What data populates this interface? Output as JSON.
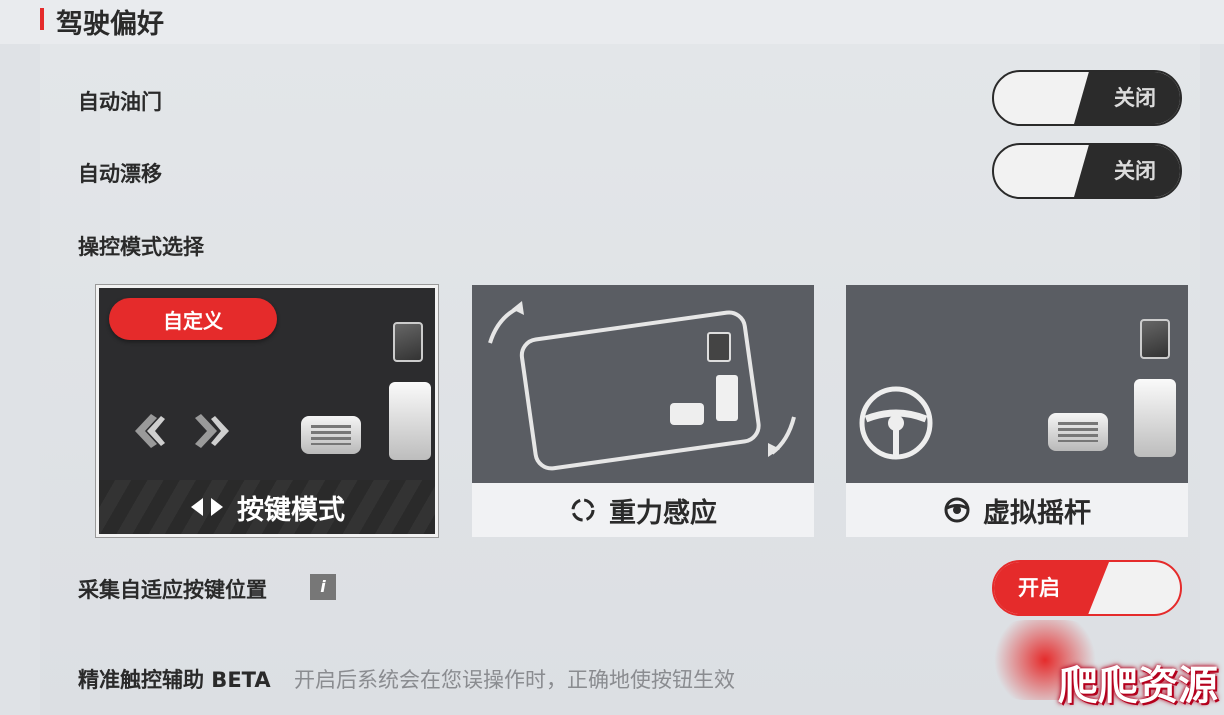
{
  "header": {
    "title": "驾驶偏好"
  },
  "settings": {
    "auto_throttle": {
      "label": "自动油门",
      "state": "关闭"
    },
    "auto_drift": {
      "label": "自动漂移",
      "state": "关闭"
    },
    "control_mode_label": "操控模式选择",
    "modes": [
      {
        "label": "按键模式",
        "badge": "自定义",
        "selected": true
      },
      {
        "label": "重力感应",
        "selected": false
      },
      {
        "label": "虚拟摇杆",
        "selected": false
      }
    ],
    "adaptive_keys": {
      "label": "采集自适应按键位置",
      "state": "开启",
      "info_icon": "i"
    },
    "precise_touch": {
      "label": "精准触控辅助 BETA",
      "description": "开启后系统会在您误操作时，正确地使按钮生效"
    }
  },
  "watermark": "爬爬资源",
  "colors": {
    "accent": "#e52b2b",
    "dark": "#2b2b2b",
    "panel": "#dcdfe3"
  }
}
